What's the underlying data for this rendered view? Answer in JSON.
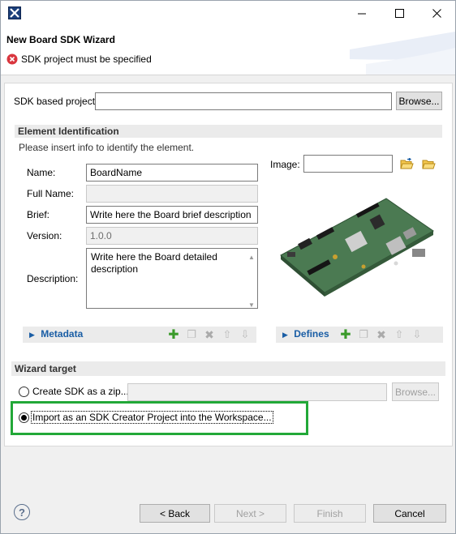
{
  "window": {
    "title": "",
    "controls": {
      "minimize": "—",
      "maximize": "☐",
      "close": "✕"
    }
  },
  "header": {
    "title": "New Board SDK Wizard",
    "error_message": "SDK project must be specified"
  },
  "sdk_project": {
    "label": "SDK based project",
    "value": "",
    "browse_label": "Browse..."
  },
  "element_identification": {
    "section_title": "Element Identification",
    "hint": "Please insert info to identify the element.",
    "name_label": "Name:",
    "name_value": "BoardName",
    "full_name_label": "Full Name:",
    "full_name_value": "",
    "brief_label": "Brief:",
    "brief_value": "Write here the Board brief description",
    "version_label": "Version:",
    "version_value": "1.0.0",
    "description_label": "Description:",
    "description_value": "Write here the Board detailed description",
    "image_label": "Image:",
    "image_value": ""
  },
  "metadata": {
    "label": "Metadata"
  },
  "defines": {
    "label": "Defines"
  },
  "wizard_target": {
    "section_title": "Wizard target",
    "zip_option_label": "Create SDK as a zip...",
    "zip_path_value": "",
    "zip_browse_label": "Browse...",
    "import_option_label": "Import as an SDK Creator Project into the Workspace...",
    "selected": "import"
  },
  "footer": {
    "back_label": "< Back",
    "next_label": "Next >",
    "finish_label": "Finish",
    "cancel_label": "Cancel"
  },
  "colors": {
    "link_blue": "#1a5ea5",
    "highlight_green": "#22a838",
    "error_red": "#d9363e",
    "add_green": "#3a9a2a"
  }
}
